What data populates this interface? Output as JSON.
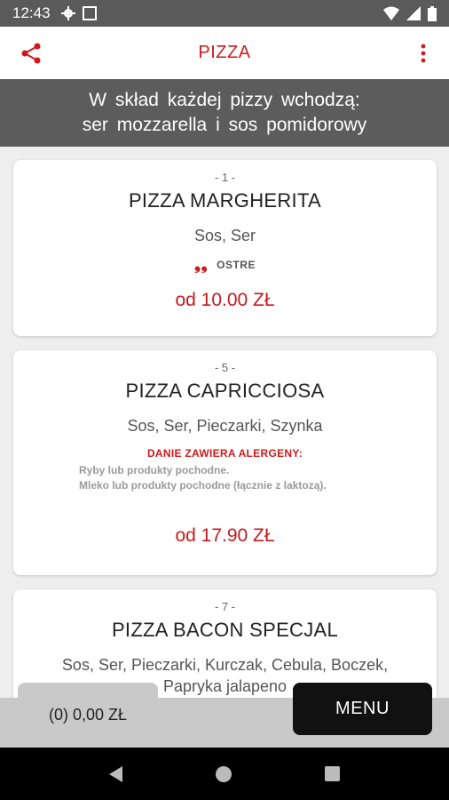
{
  "status": {
    "time": "12:43"
  },
  "appbar": {
    "title": "PIZZA"
  },
  "banner": {
    "line1": "W skład każdej pizzy wchodzą:",
    "line2": "ser mozzarella i sos pomidorowy"
  },
  "items": [
    {
      "num": "- 1 -",
      "name": "PIZZA MARGHERITA",
      "ingredients": "Sos, Ser",
      "spicy_label": "OSTRE",
      "price": "od 10.00 ZŁ"
    },
    {
      "num": "- 5 -",
      "name": "PIZZA CAPRICCIOSA",
      "ingredients": "Sos, Ser, Pieczarki, Szynka",
      "allergen_title": "DANIE ZAWIERA ALERGENY:",
      "allergens": [
        "Ryby lub produkty pochodne.",
        "Mleko lub produkty pochodne (łącznie z laktozą)."
      ],
      "price": "od 17.90 ZŁ"
    },
    {
      "num": "- 7 -",
      "name": "PIZZA BACON SPECJAL",
      "ingredients_line1": "Sos, Ser, Pieczarki, Kurczak, Cebula, Boczek,",
      "ingredients_line2": "Papryka jalapeno"
    }
  ],
  "cart": {
    "label": "(0) 0,00 ZŁ"
  },
  "menu_button": {
    "label": "MENU"
  },
  "colors": {
    "accent": "#d0191c",
    "banner": "#5c5c5c",
    "bottombar": "#c9c9c9"
  }
}
